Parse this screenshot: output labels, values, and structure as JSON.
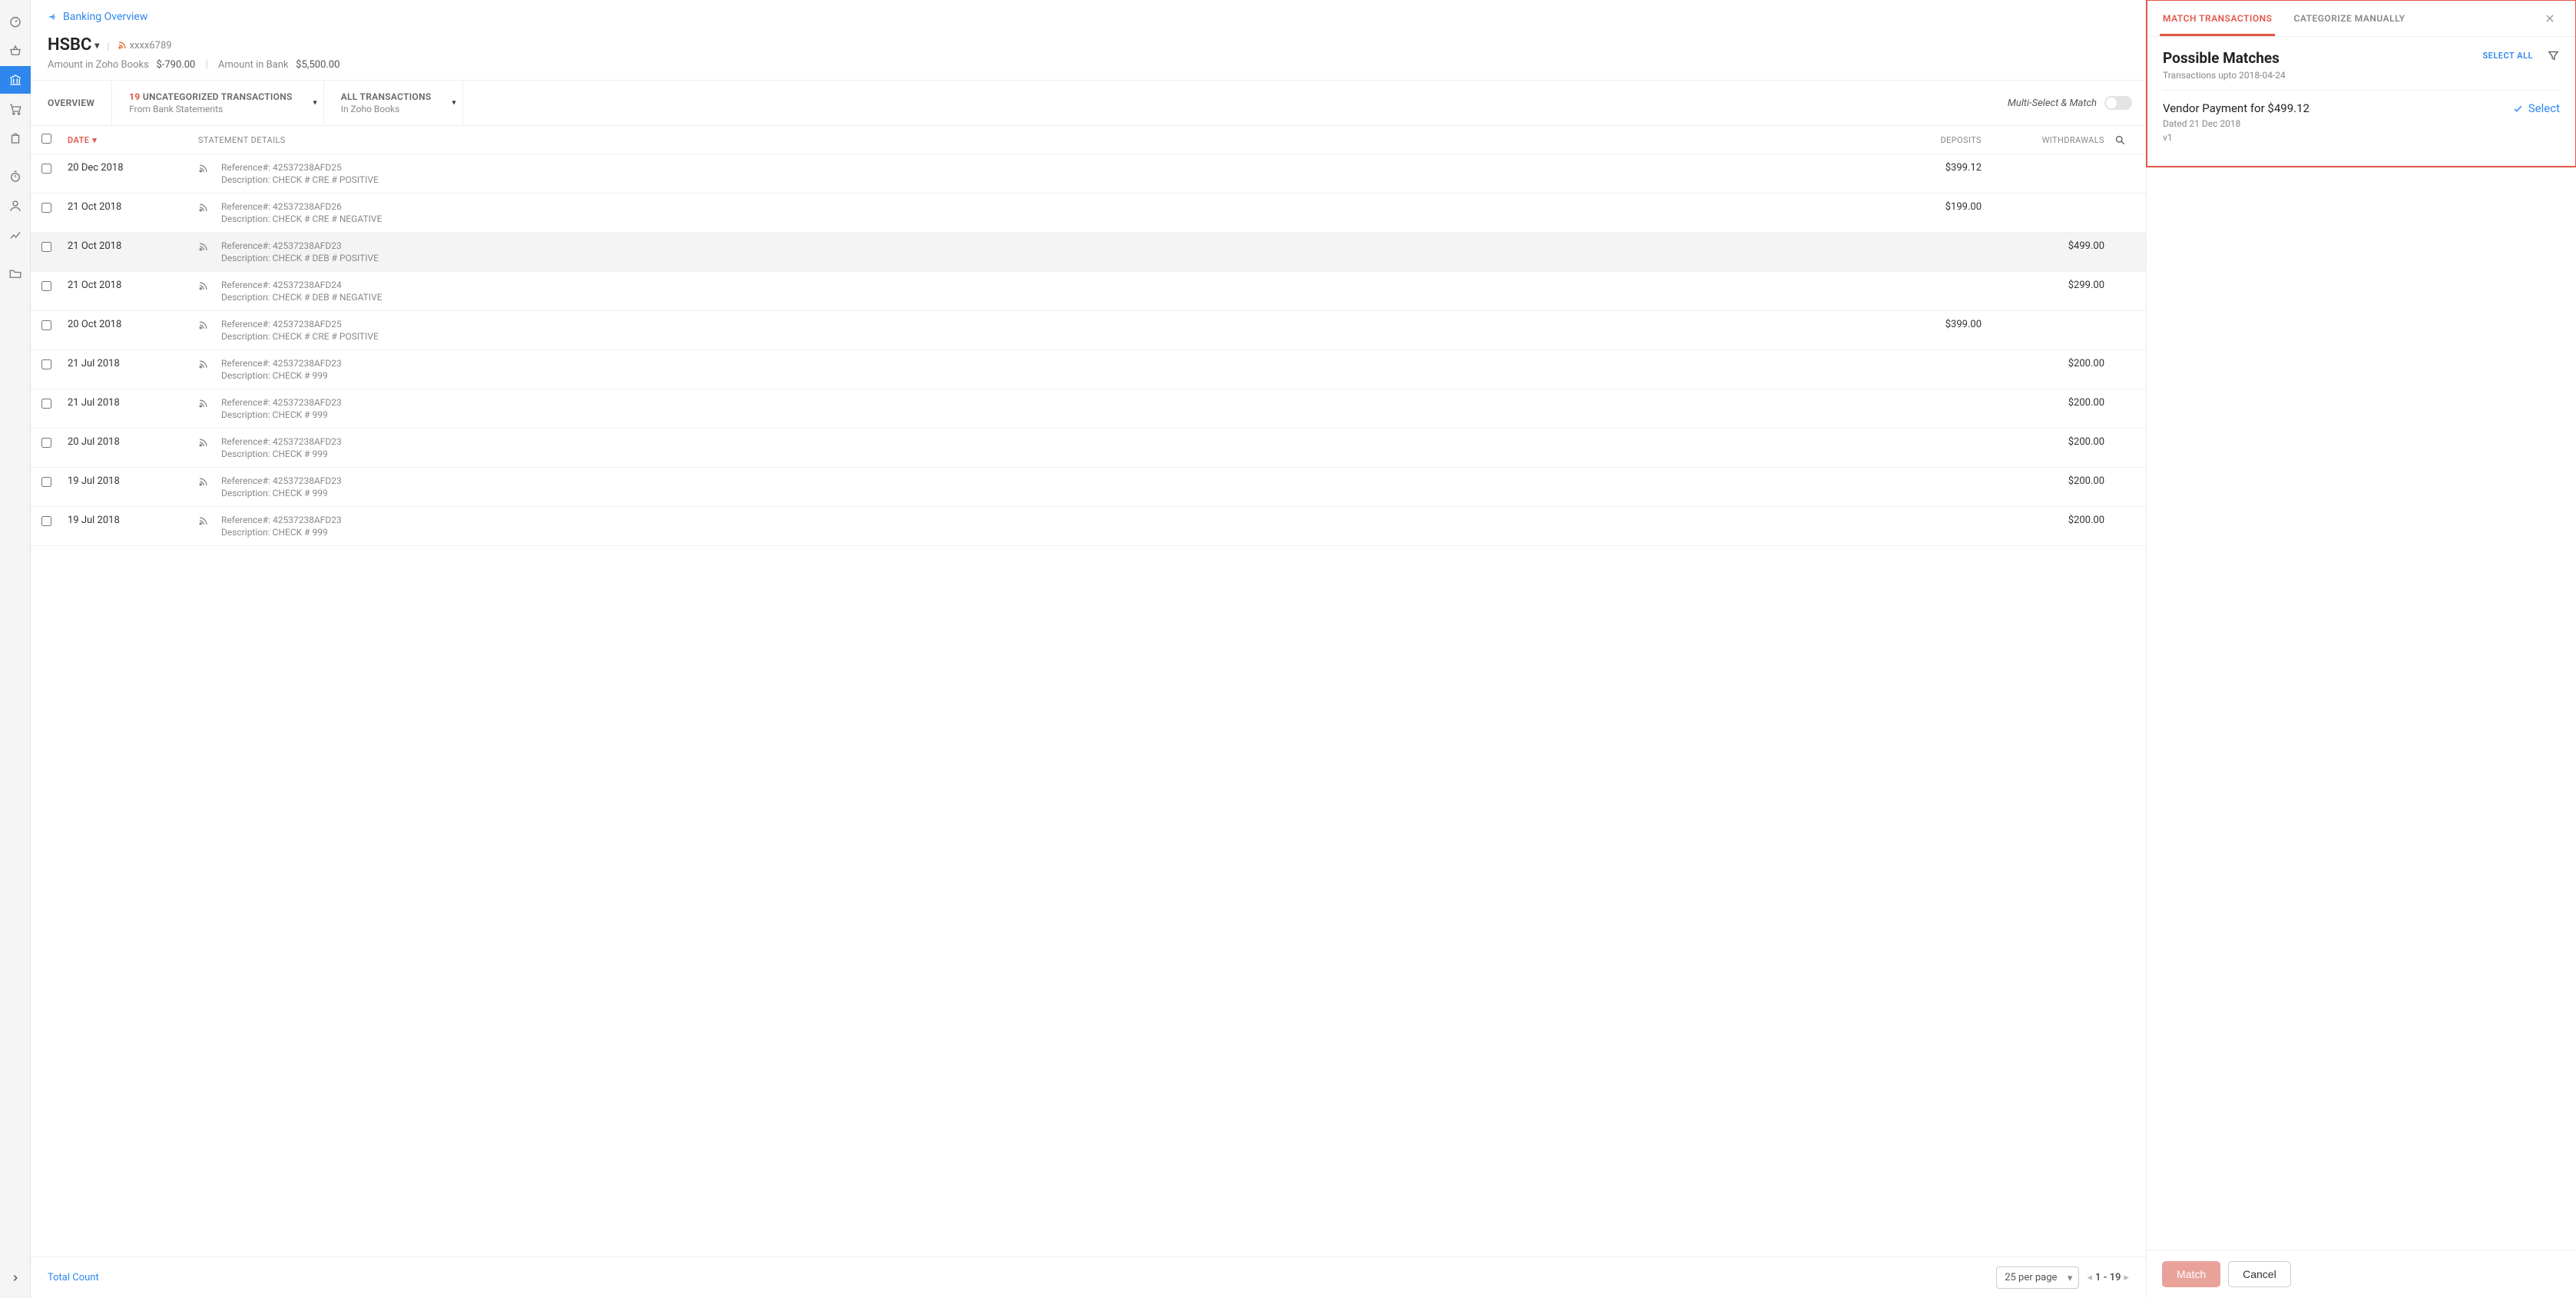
{
  "sidebar": {
    "items": [
      {
        "name": "dashboard-icon"
      },
      {
        "name": "items-icon"
      },
      {
        "name": "banking-icon",
        "active": true
      },
      {
        "name": "shopping-cart-icon"
      },
      {
        "name": "shopping-bag-icon"
      },
      {
        "name": "timer-icon"
      },
      {
        "name": "user-icon"
      },
      {
        "name": "analytics-icon"
      },
      {
        "name": "folder-icon"
      }
    ]
  },
  "header": {
    "back_link": "Banking Overview",
    "account_name": "HSBC",
    "account_suffix": "xxxx6789",
    "amount_books_label": "Amount in Zoho Books",
    "amount_books_value": "$-790.00",
    "amount_bank_label": "Amount in Bank",
    "amount_bank_value": "$5,500.00"
  },
  "toolbar": {
    "overview": "OVERVIEW",
    "uncategorized_count": "19",
    "uncategorized_label": "UNCATEGORIZED TRANSACTIONS",
    "uncategorized_sub": "From Bank Statements",
    "all_label": "ALL TRANSACTIONS",
    "all_sub": "In Zoho Books",
    "multi_match_label": "Multi-Select & Match"
  },
  "table_head": {
    "date": "DATE",
    "details": "STATEMENT DETAILS",
    "deposits": "DEPOSITS",
    "withdrawals": "WITHDRAWALS"
  },
  "rows": [
    {
      "date": "20 Dec 2018",
      "ref": "Reference#: 42537238AFD25",
      "desc": "Description: CHECK # CRE # POSITIVE",
      "deposit": "$399.12",
      "withdrawal": ""
    },
    {
      "date": "21 Oct 2018",
      "ref": "Reference#: 42537238AFD26",
      "desc": "Description: CHECK # CRE # NEGATIVE",
      "deposit": "$199.00",
      "withdrawal": ""
    },
    {
      "date": "21 Oct 2018",
      "ref": "Reference#: 42537238AFD23",
      "desc": "Description: CHECK # DEB # POSITIVE",
      "deposit": "",
      "withdrawal": "$499.00",
      "selected": true
    },
    {
      "date": "21 Oct 2018",
      "ref": "Reference#: 42537238AFD24",
      "desc": "Description: CHECK # DEB # NEGATIVE",
      "deposit": "",
      "withdrawal": "$299.00"
    },
    {
      "date": "20 Oct 2018",
      "ref": "Reference#: 42537238AFD25",
      "desc": "Description: CHECK # CRE # POSITIVE",
      "deposit": "$399.00",
      "withdrawal": ""
    },
    {
      "date": "21 Jul 2018",
      "ref": "Reference#: 42537238AFD23",
      "desc": "Description: CHECK # 999",
      "deposit": "",
      "withdrawal": "$200.00"
    },
    {
      "date": "21 Jul 2018",
      "ref": "Reference#: 42537238AFD23",
      "desc": "Description: CHECK # 999",
      "deposit": "",
      "withdrawal": "$200.00"
    },
    {
      "date": "20 Jul 2018",
      "ref": "Reference#: 42537238AFD23",
      "desc": "Description: CHECK # 999",
      "deposit": "",
      "withdrawal": "$200.00"
    },
    {
      "date": "19 Jul 2018",
      "ref": "Reference#: 42537238AFD23",
      "desc": "Description: CHECK # 999",
      "deposit": "",
      "withdrawal": "$200.00"
    },
    {
      "date": "19 Jul 2018",
      "ref": "Reference#: 42537238AFD23",
      "desc": "Description: CHECK # 999",
      "deposit": "",
      "withdrawal": "$200.00"
    }
  ],
  "footer": {
    "total_count": "Total Count",
    "per_page": "25 per page",
    "range": "1 - 19"
  },
  "panel": {
    "tab_match": "MATCH TRANSACTIONS",
    "tab_categorize": "CATEGORIZE MANUALLY",
    "pm_title": "Possible Matches",
    "pm_sub": "Transactions upto 2018-04-24",
    "select_all": "SELECT ALL",
    "match_title": "Vendor Payment for $499.12",
    "match_meta": "Dated 21 Dec 2018",
    "match_v": "v1",
    "select_label": "Select",
    "btn_match": "Match",
    "btn_cancel": "Cancel"
  }
}
